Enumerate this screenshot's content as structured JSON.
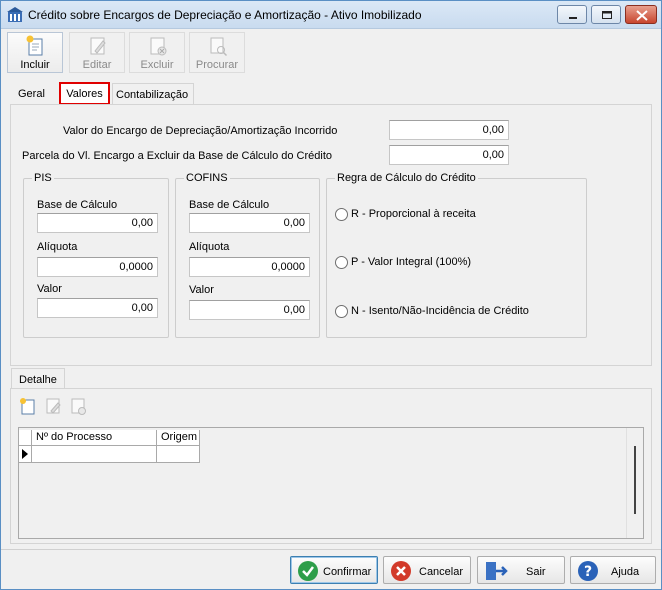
{
  "window": {
    "title": "Crédito sobre Encargos de Depreciação e Amortização - Ativo Imobilizado"
  },
  "toolbar": {
    "incluir": "Incluir",
    "editar": "Editar",
    "excluir": "Excluir",
    "procurar": "Procurar"
  },
  "tabs": {
    "geral": "Geral",
    "valores": "Valores",
    "contabilizacao": "Contabilização"
  },
  "valores": {
    "encargo_label": "Valor do Encargo de Depreciação/Amortização Incorrido",
    "encargo_value": "0,00",
    "parcela_label": "Parcela do Vl. Encargo a Excluir da Base de Cálculo do Crédito",
    "parcela_value": "0,00"
  },
  "pis": {
    "title": "PIS",
    "base_label": "Base de Cálculo",
    "base_value": "0,00",
    "aliquota_label": "Alíquota",
    "aliquota_value": "0,0000",
    "valor_label": "Valor",
    "valor_value": "0,00"
  },
  "cofins": {
    "title": "COFINS",
    "base_label": "Base de Cálculo",
    "base_value": "0,00",
    "aliquota_label": "Alíquota",
    "aliquota_value": "0,0000",
    "valor_label": "Valor",
    "valor_value": "0,00"
  },
  "regra": {
    "title": "Regra de Cálculo do Crédito",
    "options": [
      "R - Proporcional à receita",
      "P - Valor Integral (100%)",
      "N - Isento/Não-Incidência de Crédito"
    ]
  },
  "detalhe": {
    "tab": "Detalhe",
    "columns": [
      "Nº do Processo",
      "Origem"
    ]
  },
  "footer": {
    "confirmar": "Confirmar",
    "cancelar": "Cancelar",
    "sair": "Sair",
    "ajuda": "Ajuda"
  },
  "colors": {
    "highlight_tab_border": "#e00000",
    "confirm_green": "#2e9e4a",
    "cancel_red": "#d23a2a",
    "help_blue": "#2a62b8"
  }
}
